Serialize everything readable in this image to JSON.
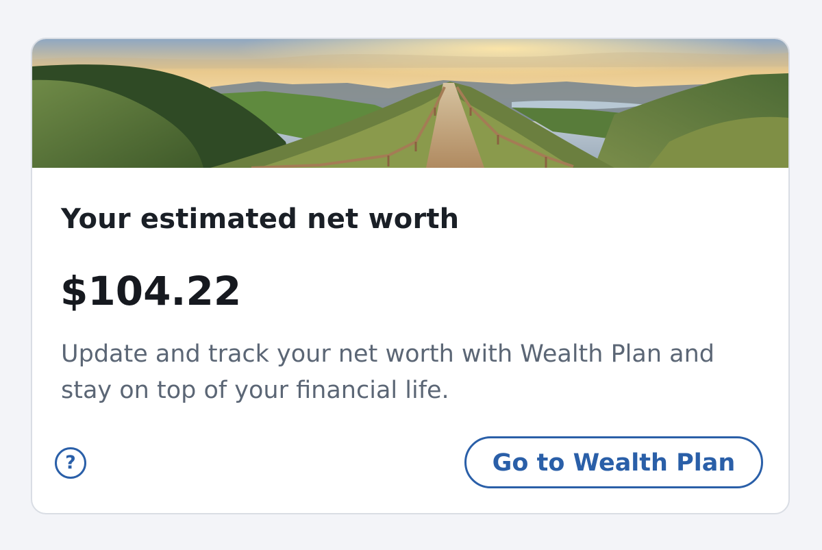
{
  "card": {
    "title": "Your estimated net worth",
    "net_worth": "$104.22",
    "description": "Update and track your net worth with Wealth Plan and stay on top of your financial life.",
    "help_icon": "question-circle-icon",
    "help_glyph": "?",
    "cta_label": "Go to Wealth Plan"
  },
  "colors": {
    "accent": "#2a5fa8",
    "title_text": "#1a1f26",
    "body_text": "#5b6675",
    "page_background": "#f3f4f8",
    "card_border": "#d9dde4"
  }
}
